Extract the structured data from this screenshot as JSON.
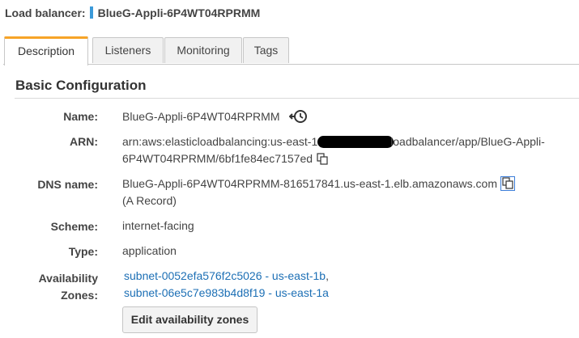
{
  "header": {
    "label": "Load balancer:",
    "name": "BlueG-Appli-6P4WT04RPRMM"
  },
  "tabs": [
    {
      "label": "Description",
      "active": true
    },
    {
      "label": "Listeners",
      "active": false
    },
    {
      "label": "Monitoring",
      "active": false
    },
    {
      "label": "Tags",
      "active": false
    }
  ],
  "section": {
    "title": "Basic Configuration"
  },
  "fields": {
    "name": {
      "label": "Name:",
      "value": "BlueG-Appli-6P4WT04RPRMM"
    },
    "arn": {
      "label": "ARN:",
      "value_start": "arn:aws:elasticloadbalancing:us-east-1:",
      "value_end": "loadbalancer/app/BlueG-Appli-",
      "value_line2": "6P4WT04RPRMM/6bf1fe84ec7157ed"
    },
    "dns": {
      "label": "DNS name:",
      "value": "BlueG-Appli-6P4WT04RPRMM-816517841.us-east-1.elb.amazonaws.com",
      "record": "(A Record)"
    },
    "scheme": {
      "label": "Scheme:",
      "value": "internet-facing"
    },
    "type": {
      "label": "Type:",
      "value": "application"
    },
    "availability": {
      "label_line1": "Availability",
      "label_line2": "Zones:",
      "zones": [
        {
          "subnet": "subnet-0052efa576f2c5026 - us-east-1b",
          "sep": ","
        },
        {
          "subnet": "subnet-06e5c7e983b4d8f19 - us-east-1a",
          "sep": ""
        }
      ]
    }
  },
  "actions": {
    "edit_zones": "Edit availability zones"
  },
  "colors": {
    "accent_tab": "#f7a428",
    "link": "#1c6fb5",
    "header_marker": "#3b9ad9"
  },
  "icons": {
    "history": "history-icon",
    "copy": "copy-icon"
  }
}
